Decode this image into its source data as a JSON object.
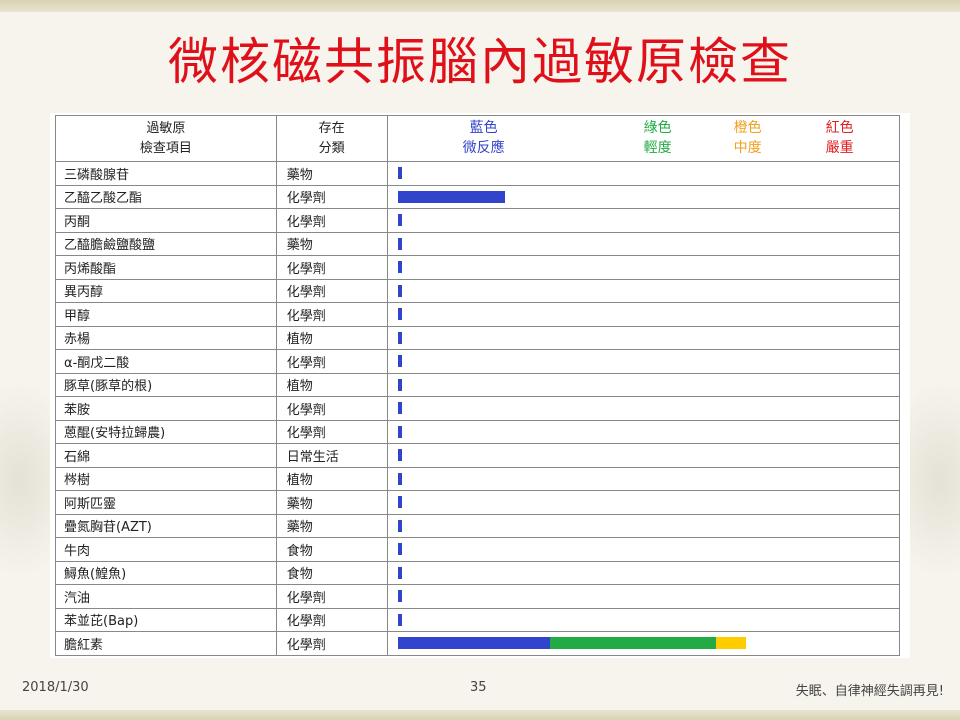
{
  "title": "微核磁共振腦內過敏原檢查",
  "footer": {
    "date": "2018/1/30",
    "page": "35",
    "note": "失眠、自律神經失調再見!"
  },
  "header": {
    "col1_line1": "過敏原",
    "col1_line2": "檢查項目",
    "col2_line1": "存在",
    "col2_line2": "分類"
  },
  "legend": [
    {
      "line1": "藍色",
      "line2": "微反應",
      "color": "#3344cc"
    },
    {
      "line1": "綠色",
      "line2": "輕度",
      "color": "#22aa44"
    },
    {
      "line1": "橙色",
      "line2": "中度",
      "color": "#f0a020"
    },
    {
      "line1": "紅色",
      "line2": "嚴重",
      "color": "#e02020"
    }
  ],
  "chart_data": {
    "type": "bar",
    "segment_colors": [
      "#3344cc",
      "#22aa44",
      "#ffcc00"
    ],
    "rows": [
      {
        "item": "三磷酸腺苷",
        "category": "藥物",
        "segments": [
          0.008
        ]
      },
      {
        "item": "乙醯乙酸乙酯",
        "category": "化學劑",
        "segments": [
          0.215
        ]
      },
      {
        "item": "丙酮",
        "category": "化學劑",
        "segments": [
          0.008
        ]
      },
      {
        "item": "乙醯膽鹼鹽酸鹽",
        "category": "藥物",
        "segments": [
          0.008
        ]
      },
      {
        "item": "丙烯酸酯",
        "category": "化學劑",
        "segments": [
          0.008
        ]
      },
      {
        "item": "異丙醇",
        "category": "化學劑",
        "segments": [
          0.008
        ]
      },
      {
        "item": "甲醇",
        "category": "化學劑",
        "segments": [
          0.008
        ]
      },
      {
        "item": "赤楊",
        "category": "植物",
        "segments": [
          0.008
        ]
      },
      {
        "item": "α-酮戊二酸",
        "category": "化學劑",
        "segments": [
          0.008
        ]
      },
      {
        "item": "豚草(豚草的根)",
        "category": "植物",
        "segments": [
          0.008
        ]
      },
      {
        "item": "苯胺",
        "category": "化學劑",
        "segments": [
          0.008
        ]
      },
      {
        "item": "蒽醌(安特拉歸農)",
        "category": "化學劑",
        "segments": [
          0.008
        ]
      },
      {
        "item": "石綿",
        "category": "日常生活",
        "segments": [
          0.008
        ]
      },
      {
        "item": "梣樹",
        "category": "植物",
        "segments": [
          0.008
        ]
      },
      {
        "item": "阿斯匹靈",
        "category": "藥物",
        "segments": [
          0.008
        ]
      },
      {
        "item": "疊氮胸苷(AZT)",
        "category": "藥物",
        "segments": [
          0.008
        ]
      },
      {
        "item": "牛肉",
        "category": "食物",
        "segments": [
          0.008
        ]
      },
      {
        "item": "鱘魚(鰉魚)",
        "category": "食物",
        "segments": [
          0.008
        ]
      },
      {
        "item": "汽油",
        "category": "化學劑",
        "segments": [
          0.008
        ]
      },
      {
        "item": "苯並芘(Bap)",
        "category": "化學劑",
        "segments": [
          0.008
        ]
      },
      {
        "item": "膽紅素",
        "category": "化學劑",
        "segments": [
          0.305,
          0.335,
          0.06
        ]
      }
    ]
  }
}
